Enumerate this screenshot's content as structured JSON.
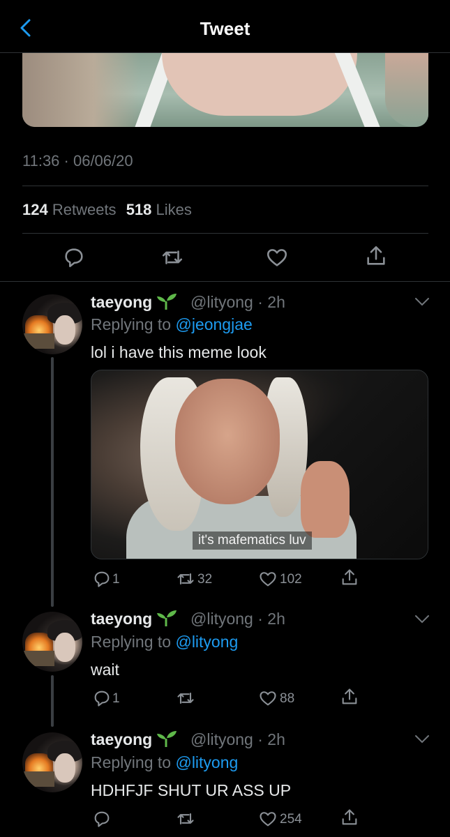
{
  "header": {
    "title": "Tweet"
  },
  "main_tweet": {
    "timestamp": "11:36 · 06/06/20",
    "retweets_count": "124",
    "retweets_label": "Retweets",
    "likes_count": "518",
    "likes_label": "Likes"
  },
  "replies": [
    {
      "name": "taeyong",
      "handle": "@lityong",
      "time": "2h",
      "replying_prefix": "Replying to",
      "replying_to": "@jeongjae",
      "text": "lol i have this meme look",
      "media_caption": "it's mafematics luv",
      "reply_count": "1",
      "retweet_count": "32",
      "like_count": "102"
    },
    {
      "name": "taeyong",
      "handle": "@lityong",
      "time": "2h",
      "replying_prefix": "Replying to",
      "replying_to": "@lityong",
      "text": "wait",
      "reply_count": "1",
      "retweet_count": "",
      "like_count": "88"
    },
    {
      "name": "taeyong",
      "handle": "@lityong",
      "time": "2h",
      "replying_prefix": "Replying to",
      "replying_to": "@lityong",
      "text": "HDHFJF SHUT UR ASS UP",
      "reply_count": "",
      "retweet_count": "",
      "like_count": "254"
    }
  ],
  "colors": {
    "background": "#000000",
    "accent": "#1d9bf0",
    "secondary_text": "#71767b",
    "primary_text": "#e7e9ea",
    "divider": "#2f3336",
    "sprout": "#5fb84a"
  },
  "icons": [
    "back-chevron-icon",
    "reply-icon",
    "retweet-icon",
    "like-icon",
    "share-icon",
    "caret-down-icon",
    "sprout-emoji-icon"
  ]
}
